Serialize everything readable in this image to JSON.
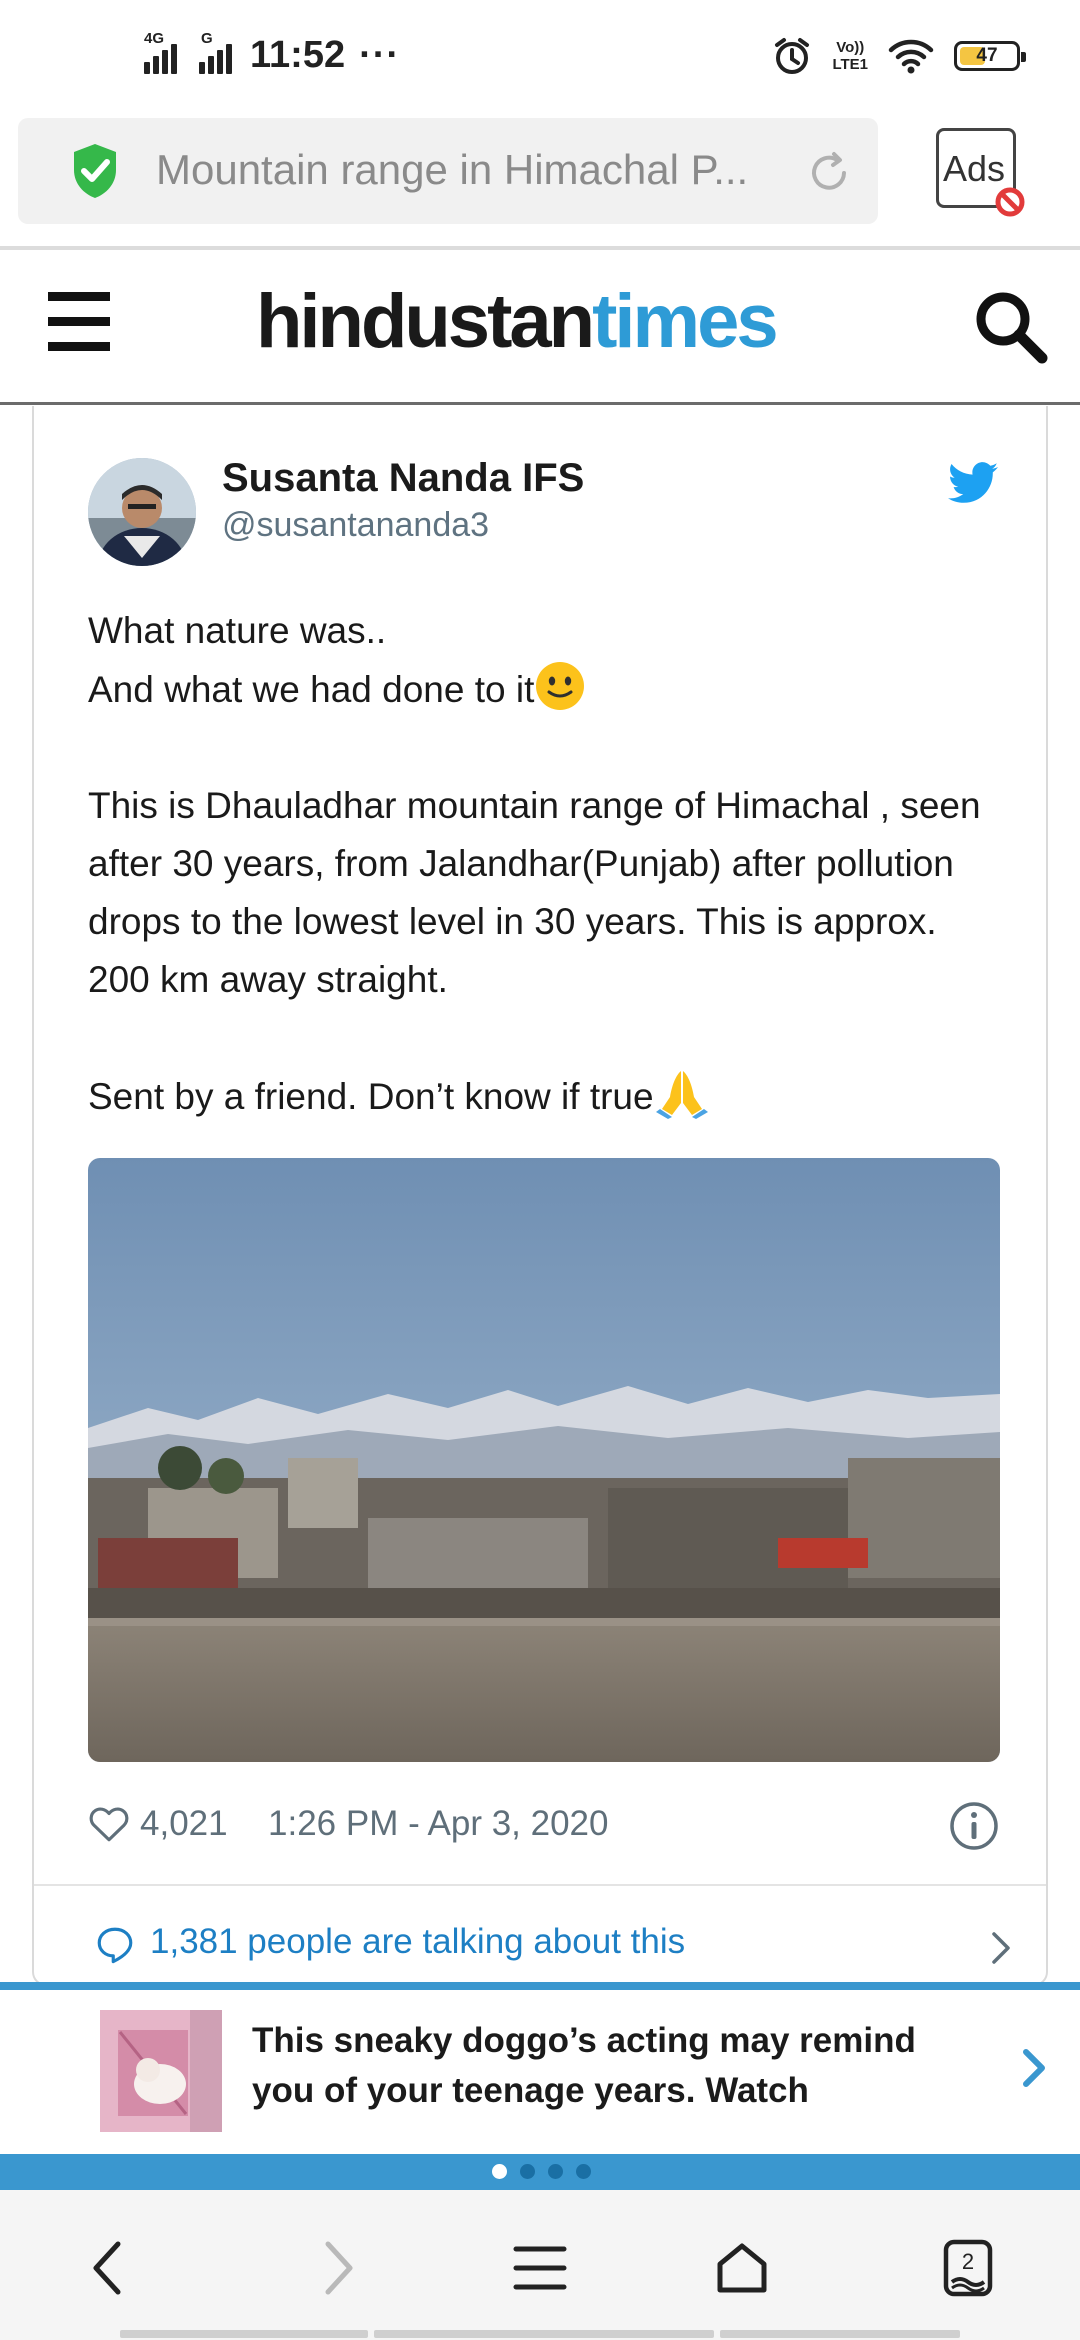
{
  "status_bar": {
    "network_1": "4G",
    "network_2": "G",
    "time": "11:52",
    "more": "···",
    "volte_1": "Vo))",
    "volte_2": "LTE1",
    "battery": "47",
    "battery_level_pct": 47
  },
  "browser": {
    "url_text": "Mountain range in Himachal P...",
    "ads_label": "Ads"
  },
  "site": {
    "logo_part1": "hindustan",
    "logo_part2": "times"
  },
  "tweet": {
    "author_name": "Susanta Nanda IFS",
    "author_handle": "@susantananda3",
    "line1": "What nature was..",
    "line2": "And what we had done to it",
    "line3": "This is Dhauladhar mountain range of  Himachal , seen after 30 years, from Jalandhar(Punjab) after pollution drops to the lowest level in 30 years. This is approx. 200 km away straight.",
    "line4": "Sent by a friend. Don’t know if true",
    "likes": "4,021",
    "timestamp": "1:26 PM - Apr 3, 2020",
    "talking": "1,381 people are talking about this"
  },
  "ad": {
    "text": "This sneaky doggo’s acting may remind you of your teenage years. Watch"
  },
  "carousel": {
    "active_index": 0,
    "count": 4
  },
  "bottom_nav": {
    "tabs_count": "2"
  },
  "colors": {
    "accent_blue": "#3a97cf",
    "logo_blue": "#2e9bd6",
    "link_blue": "#1d7fc4",
    "twitter_blue": "#1da1f2",
    "shield_green": "#35b84a"
  }
}
